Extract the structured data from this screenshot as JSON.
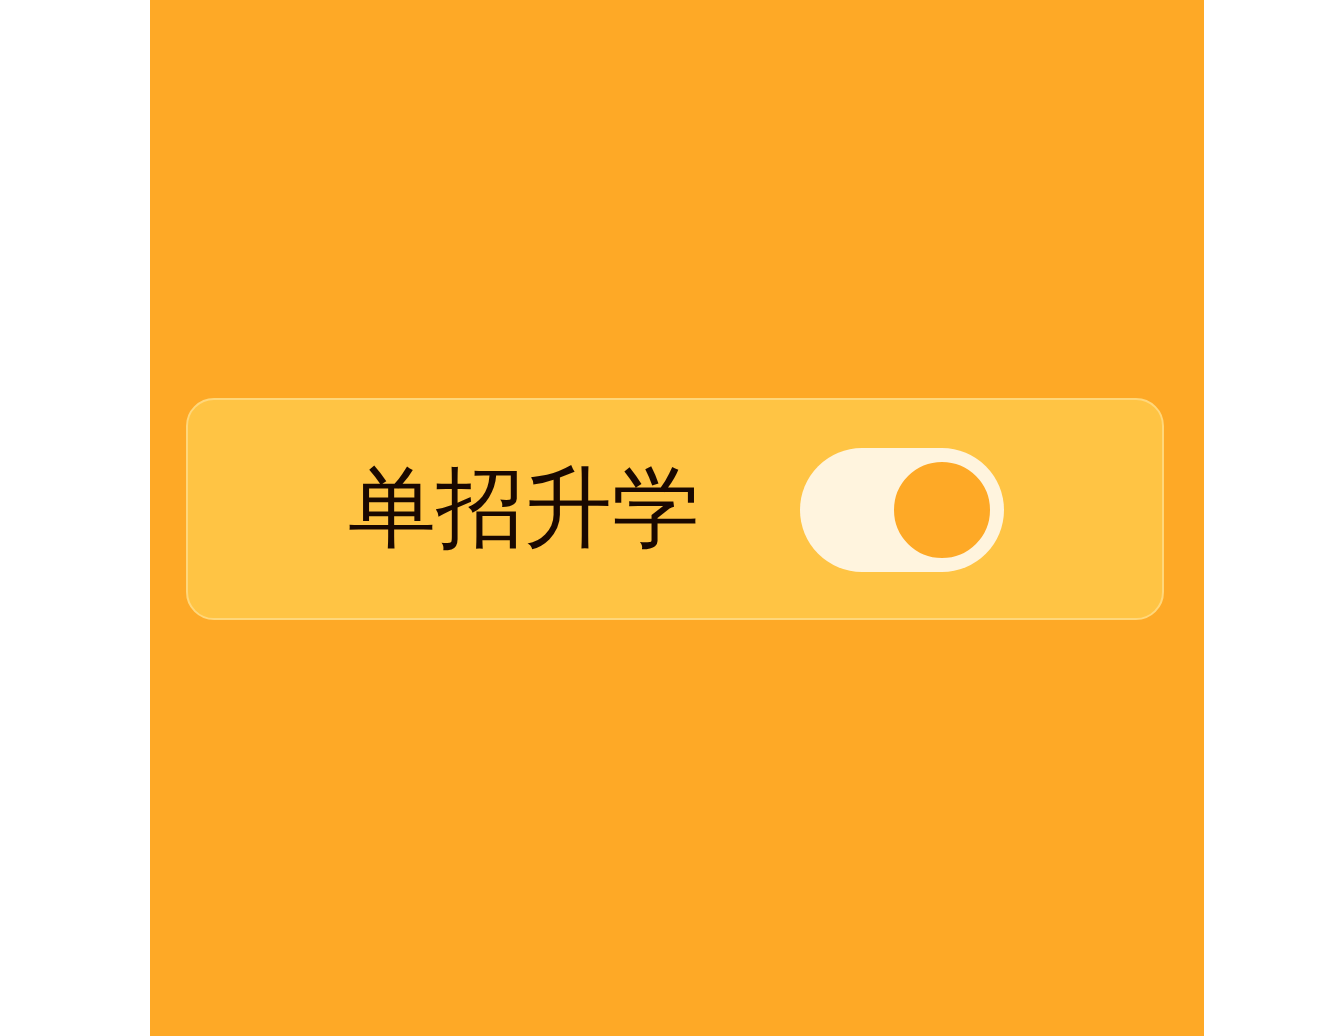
{
  "card": {
    "label": "单招升学",
    "toggle": {
      "on": true
    }
  }
}
